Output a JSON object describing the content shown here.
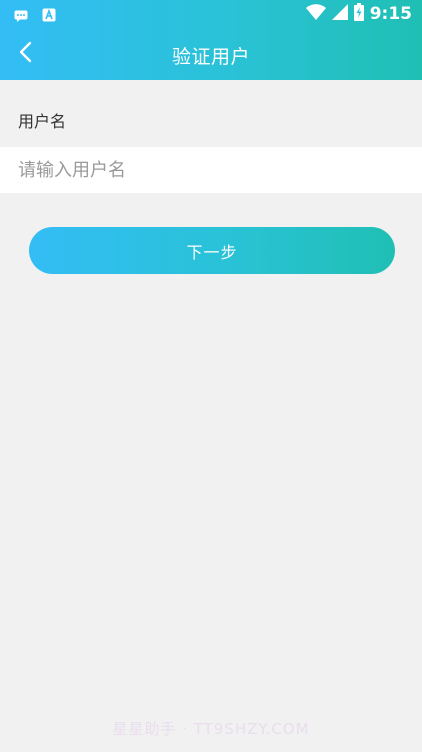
{
  "status_bar": {
    "time": "9:15",
    "left_icons": [
      "message-icon",
      "a-letter-icon"
    ],
    "right_icons": [
      "wifi-icon",
      "signal-icon",
      "battery-charging-icon"
    ]
  },
  "app_bar": {
    "title": "验证用户",
    "back_icon": "chevron-left-icon"
  },
  "form": {
    "username_label": "用户名",
    "username_placeholder": "请输入用户名",
    "username_value": ""
  },
  "actions": {
    "next_label": "下一步"
  },
  "watermark": "星星助手 · TT9SHZY.COM",
  "colors": {
    "gradient_start": "#33bdf5",
    "gradient_end": "#20bfb4",
    "page_bg": "#f1f1f2"
  }
}
